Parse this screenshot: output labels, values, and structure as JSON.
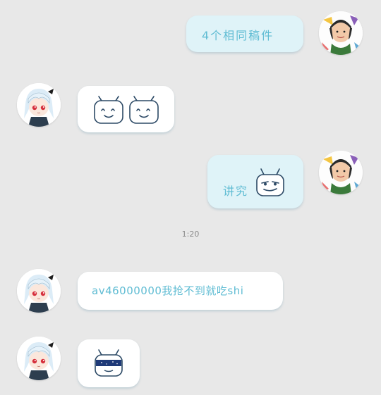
{
  "messages": [
    {
      "side": "right",
      "text": "4个相同稿件"
    },
    {
      "side": "left",
      "sticker": "two-tv-emoji-faces"
    },
    {
      "side": "right",
      "text": "讲究",
      "sticker": "smug-tv-emoji"
    },
    {
      "side": "left",
      "text": "av46000000我抢不到就吃shi"
    },
    {
      "side": "left",
      "sticker": "sunglasses-tv-emoji"
    }
  ],
  "timestamp": "1:20",
  "colors": {
    "background": "#e8e8e8",
    "bubble_self": "#dff3f8",
    "bubble_other": "#ffffff",
    "text": "#5fbcd3",
    "outline": "#2d4a66"
  }
}
